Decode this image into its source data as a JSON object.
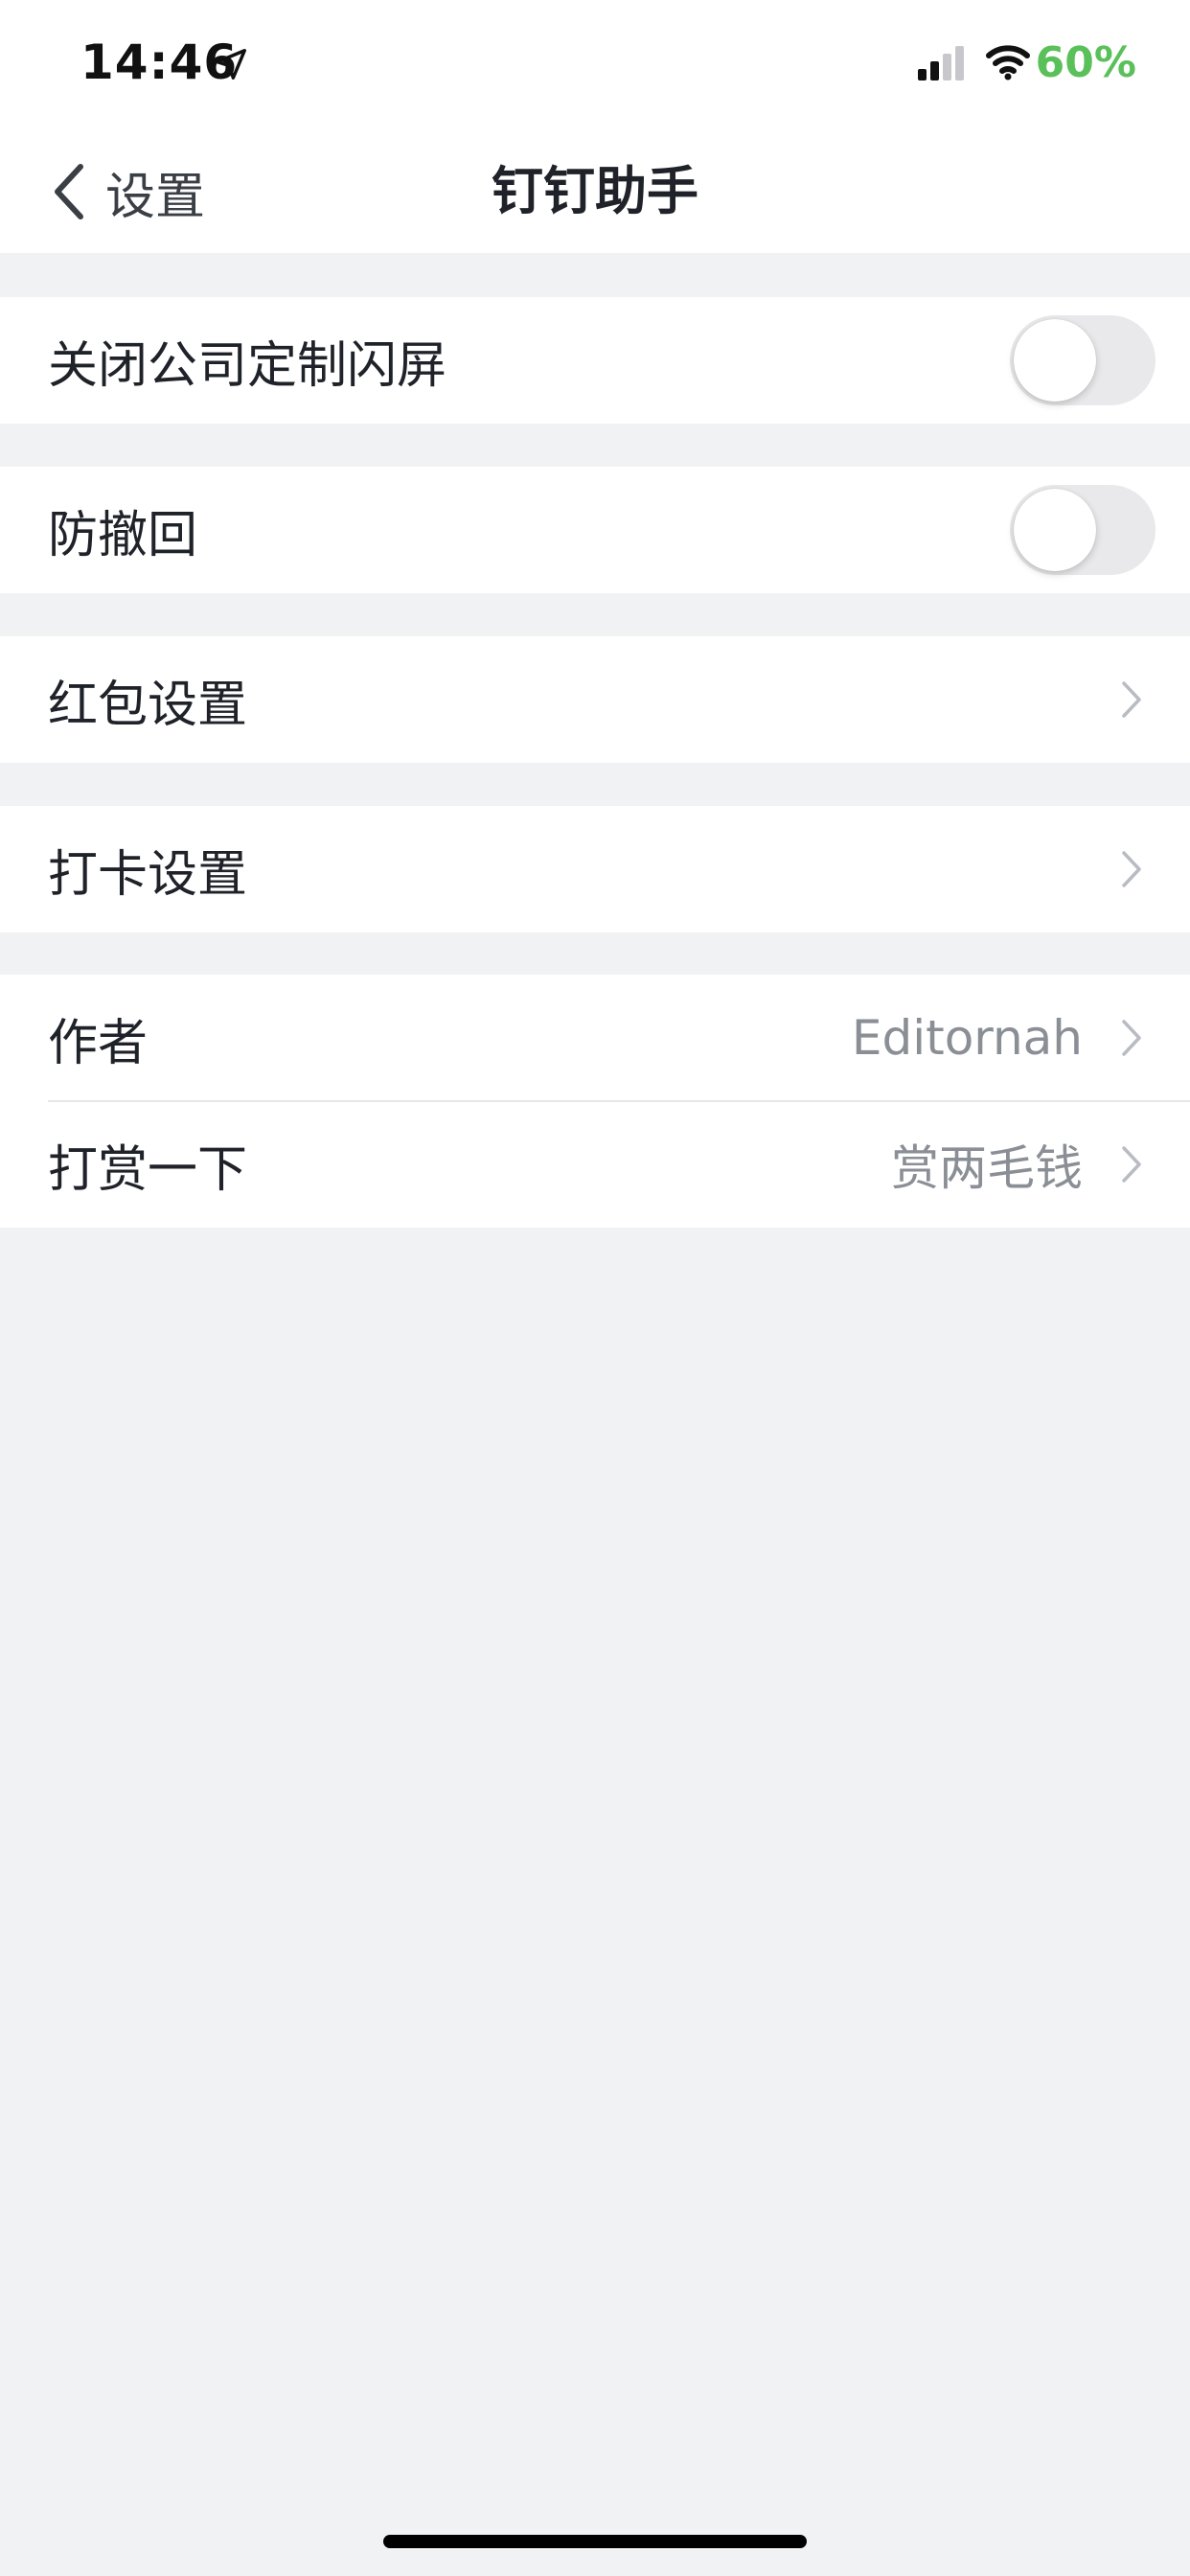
{
  "status_bar": {
    "time": "14:46",
    "battery": "60%",
    "battery_color": "#5ac05a",
    "icons": [
      "location-icon",
      "signal-icon",
      "wifi-icon"
    ]
  },
  "nav": {
    "back_label": "设置",
    "title": "钉钉助手",
    "back_icon": "chevron-left-icon"
  },
  "settings": {
    "close_splash": {
      "label": "关闭公司定制闪屏",
      "enabled": false
    },
    "anti_recall": {
      "label": "防撤回",
      "enabled": false
    },
    "red_packet": {
      "label": "红包设置"
    },
    "check_in": {
      "label": "打卡设置"
    },
    "author": {
      "label": "作者",
      "value": "Editornah"
    },
    "tip": {
      "label": "打赏一下",
      "value": "赏两毛钱"
    }
  },
  "colors": {
    "background": "#f1f2f4",
    "toggle_off": "#e9e9eb",
    "secondary_text": "#8a8e95"
  }
}
